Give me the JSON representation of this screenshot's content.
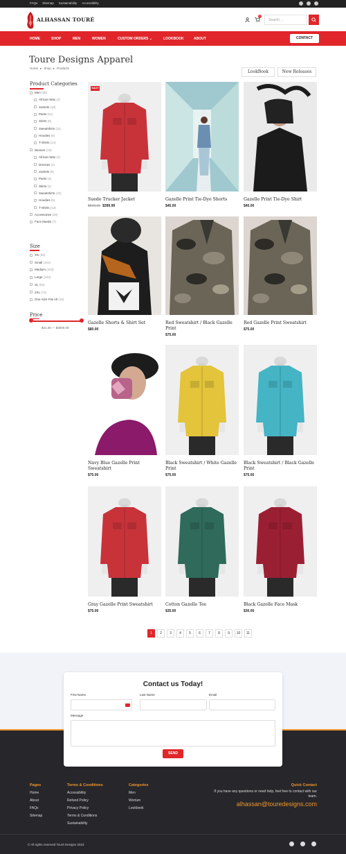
{
  "topbar": {
    "links": [
      "FAQs",
      "Sitemap",
      "Sustainability",
      "Accessibility"
    ],
    "social_icons": [
      "instagram-icon",
      "facebook-icon",
      "twitter-icon"
    ]
  },
  "brand": {
    "name": "ALHASSAN TOURÉ",
    "accent": "#e0262a",
    "footer_accent": "#f0962a"
  },
  "header": {
    "search_placeholder": "Search ...",
    "cart_count": "0"
  },
  "nav": {
    "items": [
      "HOME",
      "SHOP",
      "MEN",
      "WOMEN",
      "CUSTOM ORDERS ⌄",
      "LOOKBOOK",
      "ABOUT"
    ],
    "contact": "CONTACT"
  },
  "page": {
    "title": "Toure Designs Apparel",
    "breadcrumb": [
      "Home",
      "Shop",
      "Products"
    ],
    "chips": [
      "LookBook",
      "New Releases"
    ]
  },
  "sidebar": {
    "categories_title": "Product Categories",
    "categories": [
      {
        "label": "Men",
        "count": "(38)",
        "level": 0
      },
      {
        "label": "African Wax",
        "count": "(4)",
        "level": 1
      },
      {
        "label": "Jackets",
        "count": "(19)",
        "level": 1
      },
      {
        "label": "Pants",
        "count": "(11)",
        "level": 1
      },
      {
        "label": "Shirts",
        "count": "(8)",
        "level": 1
      },
      {
        "label": "Sweatshirts",
        "count": "(11)",
        "level": 1
      },
      {
        "label": "Hoodies",
        "count": "(8)",
        "level": 1
      },
      {
        "label": "T-Shirts",
        "count": "(14)",
        "level": 1
      },
      {
        "label": "Women",
        "count": "(19)",
        "level": 0
      },
      {
        "label": "African Wax",
        "count": "(3)",
        "level": 1
      },
      {
        "label": "Dresses",
        "count": "(1)",
        "level": 1
      },
      {
        "label": "Jackets",
        "count": "(5)",
        "level": 1
      },
      {
        "label": "Pants",
        "count": "(4)",
        "level": 1
      },
      {
        "label": "Skirts",
        "count": "(2)",
        "level": 1
      },
      {
        "label": "Sweatshirts",
        "count": "(10)",
        "level": 1
      },
      {
        "label": "Hoodies",
        "count": "(5)",
        "level": 1
      },
      {
        "label": "T-Shirts",
        "count": "(13)",
        "level": 1
      },
      {
        "label": "Accessories",
        "count": "(25)",
        "level": 0
      },
      {
        "label": "Face Masks",
        "count": "(7)",
        "level": 0
      }
    ],
    "size_title": "Size",
    "sizes": [
      {
        "label": "XS",
        "count": "(25)"
      },
      {
        "label": "Small",
        "count": "(101)"
      },
      {
        "label": "Medium",
        "count": "(103)"
      },
      {
        "label": "Large",
        "count": "(102)"
      },
      {
        "label": "XL",
        "count": "(84)"
      },
      {
        "label": "2XL",
        "count": "(74)"
      },
      {
        "label": "One Size Fits All",
        "count": "(19)"
      }
    ],
    "price_title": "Price",
    "price_range": "$21.00 — $3000.00"
  },
  "products": [
    {
      "name": "Suede Trucker Jacket",
      "old_price": "$500.00",
      "price": "$399.99",
      "sale": "SALE!"
    },
    {
      "name": "Gazelle Print Tie-Dye Shorts",
      "price": "$45.00"
    },
    {
      "name": "Gazelle Print Tie-Dye Shirt",
      "price": "$40.00"
    },
    {
      "name": "Gazelle Shorts & Shirt Set",
      "price": "$80.00"
    },
    {
      "name": "Red Sweatshirt / Black Gazelle Print",
      "price": "$75.00"
    },
    {
      "name": "Red Gazelle Print Sweatshirt",
      "price": "$75.00"
    },
    {
      "name": "Navy Blue Gazelle Print Sweatshirt",
      "price": "$75.00"
    },
    {
      "name": "Black Sweatshirt / White Gazelle Print",
      "price": "$75.00"
    },
    {
      "name": "Black Sweatshirt / Black Gazelle Print",
      "price": "$75.00"
    },
    {
      "name": "Gray Gazelle Print Sweatshirt",
      "price": "$75.00"
    },
    {
      "name": "Cotton Gazelle Tee",
      "price": "$35.00"
    },
    {
      "name": "Black Gazelle Face Mask",
      "price": "$30.00"
    }
  ],
  "pagination": [
    "1",
    "2",
    "3",
    "4",
    "5",
    "6",
    "7",
    "8",
    "9",
    "10",
    "11"
  ],
  "contact_form": {
    "title": "Contact us Today!",
    "first_name": "First Name",
    "last_name": "Last Name",
    "email": "Email",
    "message": "Message",
    "send": "SEND"
  },
  "footer": {
    "pages_title": "Pages",
    "pages": [
      "Home",
      "About",
      "FAQs",
      "Sitemap"
    ],
    "terms_title": "Terms & Conditions",
    "terms": [
      "Accessibility",
      "Refund Policy",
      "Privacy Policy",
      "Terms & Conditions",
      "Sustainability"
    ],
    "cat_title": "Categories",
    "cats": [
      "Men",
      "Women",
      "Lookbook"
    ],
    "qc_title": "Quick Contact",
    "qc_text": "If you have any questions or need help, feel free to contact with our team.",
    "qc_email": "alhassan@touredesigns.com",
    "copyright": "© All rights reserved Touré Designs 2023"
  }
}
